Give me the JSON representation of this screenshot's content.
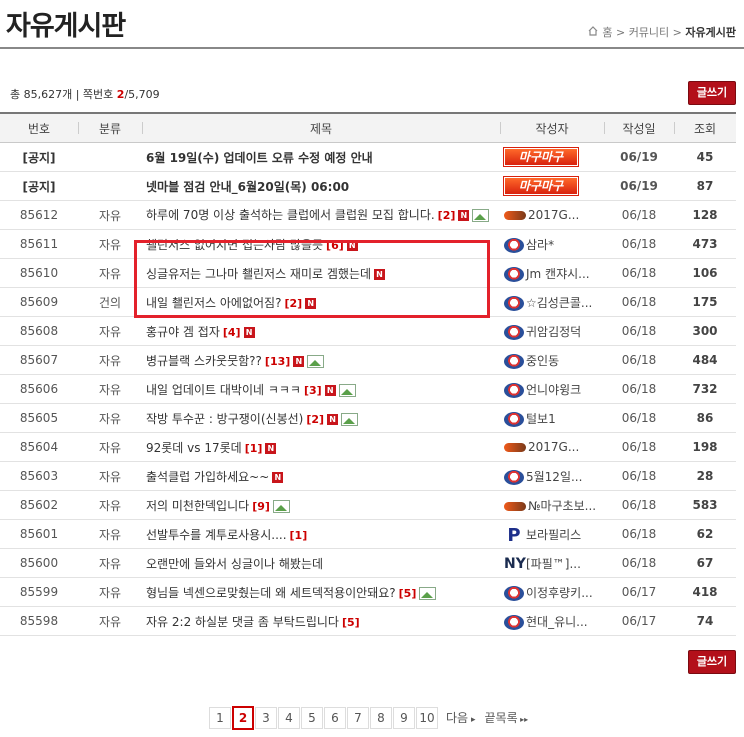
{
  "page": {
    "title": "자유게시판"
  },
  "breadcrumb": {
    "home": "홈",
    "community": "커뮤니티",
    "current": "자유게시판",
    "sep": ">"
  },
  "summary": {
    "prefix": "총 ",
    "total": "85,627개",
    "sep": " | 쪽번호 ",
    "current_page": "2",
    "page_total": "/5,709"
  },
  "write_label": "글쓰기",
  "columns": [
    "번호",
    "분류",
    "제목",
    "작성자",
    "작성일",
    "조회"
  ],
  "logo_text": "마구마구",
  "rows": [
    {
      "num": "[공지]",
      "cat": "",
      "subject": "6월 19일(수) 업데이트 오류 수정 예정 안내",
      "author": "마구마구",
      "date": "06/19",
      "views": "45",
      "notice": true
    },
    {
      "num": "[공지]",
      "cat": "",
      "subject": "넷마블 점검 안내_6월20일(목) 06:00",
      "author": "마구마구",
      "date": "06/19",
      "views": "87",
      "notice": true
    },
    {
      "num": "85612",
      "cat": "자유",
      "subject": "하루에 70명 이상 출석하는 클럽에서 클럽원 모집 합니다.",
      "comments": "[2]",
      "new": true,
      "img": true,
      "author": "2017G...",
      "team": "b",
      "date": "06/18",
      "views": "128",
      "wrap": true
    },
    {
      "num": "85611",
      "cat": "자유",
      "subject": "쵈린저스 없어지면 접는사람 많을듯",
      "comments": "[6]",
      "new": true,
      "author": "삼라*",
      "team": "a",
      "date": "06/18",
      "views": "473"
    },
    {
      "num": "85610",
      "cat": "자유",
      "subject": "싱글유저는 그나마 쵈린저스 재미로 겜했는데",
      "new": true,
      "author": "Jm 캔쟈시...",
      "team": "a",
      "date": "06/18",
      "views": "106"
    },
    {
      "num": "85609",
      "cat": "건의",
      "subject": "내일 쵈린저스 아에없어짐?",
      "comments": "[2]",
      "new": true,
      "author": "☆김성큰콜...",
      "team": "a",
      "date": "06/18",
      "views": "175"
    },
    {
      "num": "85608",
      "cat": "자유",
      "subject": "홍규야 겜 접자",
      "comments": "[4]",
      "new": true,
      "author": "귀암김정덕",
      "team": "a",
      "date": "06/18",
      "views": "300"
    },
    {
      "num": "85607",
      "cat": "자유",
      "subject": "병규블랙 스카웃뭇함??",
      "comments": "[13]",
      "new": true,
      "img": true,
      "author": "중인동",
      "team": "a",
      "date": "06/18",
      "views": "484"
    },
    {
      "num": "85606",
      "cat": "자유",
      "subject": "내일 업데이트 대박이네 ㅋㅋㅋ",
      "comments": "[3]",
      "new": true,
      "img": true,
      "author": "언니야윙크",
      "team": "a",
      "date": "06/18",
      "views": "732"
    },
    {
      "num": "85605",
      "cat": "자유",
      "subject": "작방 투수꾼 : 방구쟁이(신봉선)",
      "comments": "[2]",
      "new": true,
      "img": true,
      "author": "털보1",
      "team": "a",
      "date": "06/18",
      "views": "86"
    },
    {
      "num": "85604",
      "cat": "자유",
      "subject": "92롯데 vs 17롯데",
      "comments": "[1]",
      "new": true,
      "author": "2017G...",
      "team": "b",
      "date": "06/18",
      "views": "198"
    },
    {
      "num": "85603",
      "cat": "자유",
      "subject": "출석클럽 가입하세요~~",
      "new": true,
      "author": "5월12일...",
      "team": "a",
      "date": "06/18",
      "views": "28"
    },
    {
      "num": "85602",
      "cat": "자유",
      "subject": "저의 미천한덱입니다",
      "comments": "[9]",
      "img": true,
      "author": "№마구초보...",
      "team": "b",
      "date": "06/18",
      "views": "583"
    },
    {
      "num": "85601",
      "cat": "자유",
      "subject": "선발투수를 계투로사용시....",
      "comments": "[1]",
      "author": "보라필리스",
      "team": "p",
      "date": "06/18",
      "views": "62"
    },
    {
      "num": "85600",
      "cat": "자유",
      "subject": "오랜만에 들와서 싱글이나 해봤는데",
      "author": "[파필™]...",
      "team": "ny",
      "date": "06/18",
      "views": "67"
    },
    {
      "num": "85599",
      "cat": "자유",
      "subject": "형님들 넥센으로맞췄는데 왜 세트덱적용이안돼요?",
      "comments": "[5]",
      "img": true,
      "author": "이정후량키...",
      "team": "a",
      "date": "06/17",
      "views": "418"
    },
    {
      "num": "85598",
      "cat": "자유",
      "subject": "자유 2:2 하실분 댓글 좀 부탁드립니다",
      "comments": "[5]",
      "author": "현대_유니...",
      "team": "a",
      "date": "06/17",
      "views": "74"
    }
  ],
  "pagination": {
    "pages": [
      "1",
      "2",
      "3",
      "4",
      "5",
      "6",
      "7",
      "8",
      "9",
      "10"
    ],
    "current": "2",
    "next": "다음",
    "last": "끝목록"
  },
  "icons": {
    "new": "N",
    "team_p": "P",
    "team_ny": "NY"
  }
}
